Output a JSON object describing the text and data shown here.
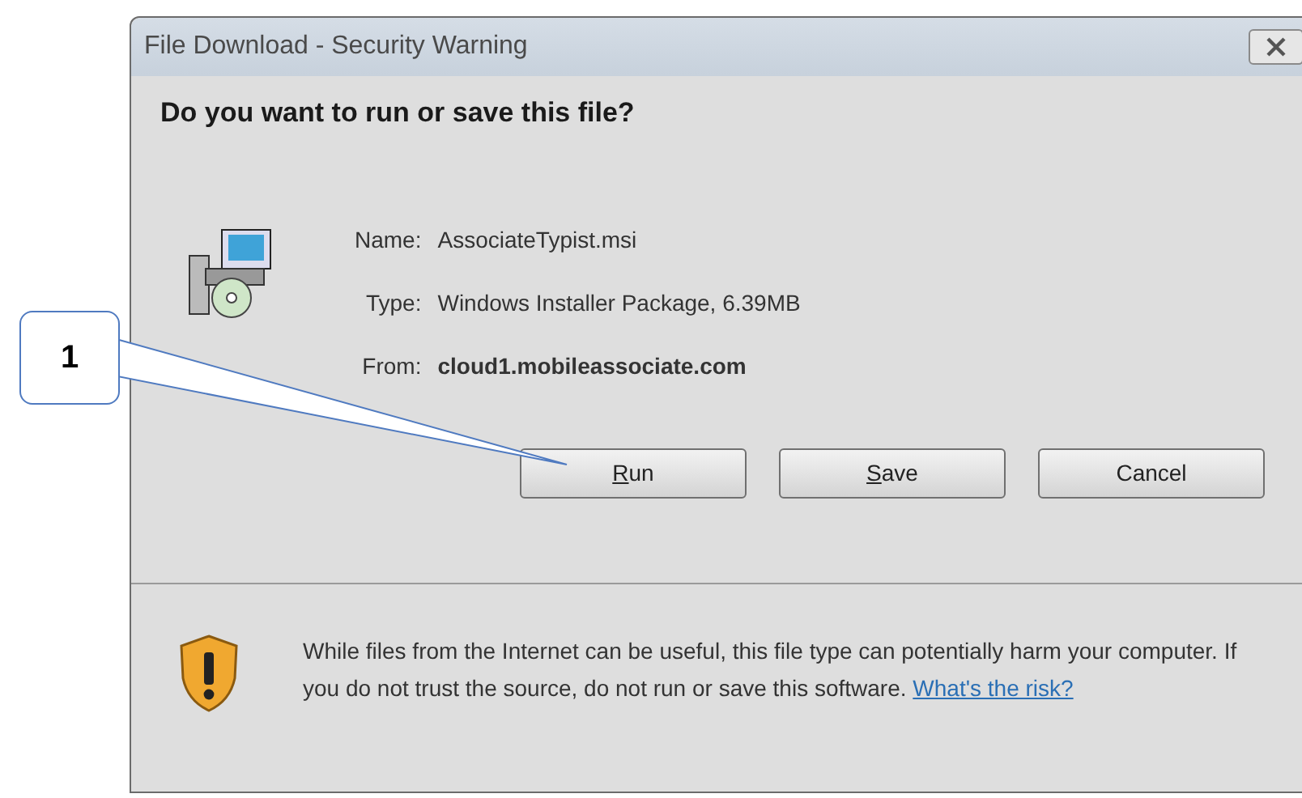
{
  "window": {
    "title": "File Download - Security Warning"
  },
  "heading": "Do you want to run or save this file?",
  "fields": [
    {
      "label": "Name:",
      "value": "AssociateTypist.msi",
      "bold": false
    },
    {
      "label": "Type:",
      "value": "Windows Installer Package, 6.39MB",
      "bold": false
    },
    {
      "label": "From:",
      "value": "cloud1.mobileassociate.com",
      "bold": true
    }
  ],
  "buttons": [
    {
      "label": "Run",
      "mnemonic": true
    },
    {
      "label": "Save",
      "mnemonic": true
    },
    {
      "label": "Cancel",
      "mnemonic": false
    }
  ],
  "warning": {
    "text": "While files from the Internet can be useful, this file type can potentially harm your computer. If you do not trust the source, do not run or save this software.",
    "link": "What's the risk?"
  },
  "callout": {
    "label": "1"
  }
}
